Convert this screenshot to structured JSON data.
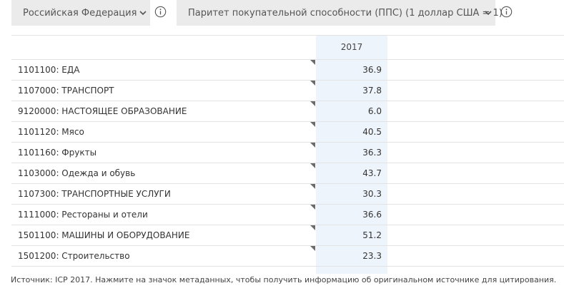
{
  "toolbar": {
    "country_select": {
      "value": "Российская Федерация"
    },
    "measure_select": {
      "value": "Паритет покупательной способности (ППС) (1 доллар США = 1)"
    }
  },
  "icons": {
    "country_dropdown": "chevron-down-icon",
    "country_info": "info-icon",
    "measure_dropdown": "chevron-down-icon",
    "measure_info": "info-icon"
  },
  "table": {
    "header": {
      "year": "2017"
    },
    "rows": [
      {
        "name": "1101100: ЕДА",
        "value": "36.9"
      },
      {
        "name": "1107000: ТРАНСПОРТ",
        "value": "37.8"
      },
      {
        "name": "9120000: НАСТОЯЩЕЕ ОБРАЗОВАНИЕ",
        "value": "6.0"
      },
      {
        "name": "1101120: Мясо",
        "value": "40.5"
      },
      {
        "name": "1101160: Фрукты",
        "value": "36.3"
      },
      {
        "name": "1103000: Одежда и обувь",
        "value": "43.7"
      },
      {
        "name": "1107300: ТРАНСПОРТНЫЕ УСЛУГИ",
        "value": "30.3"
      },
      {
        "name": "1111000: Рестораны и отели",
        "value": "36.6"
      },
      {
        "name": "1501100: МАШИНЫ И ОБОРУДОВАНИЕ",
        "value": "51.2"
      },
      {
        "name": "1501200: Строительство",
        "value": "23.3"
      }
    ]
  },
  "source_note": "Источник: ICP 2017. Нажмите на значок метаданных, чтобы получить информацию об оригинальном источнике для цитирования.",
  "colors": {
    "select_bg": "#ebebeb",
    "highlight_column": "#eef4fb",
    "row_border": "#e3e3e3",
    "corner_marker": "#6b6b6b"
  }
}
